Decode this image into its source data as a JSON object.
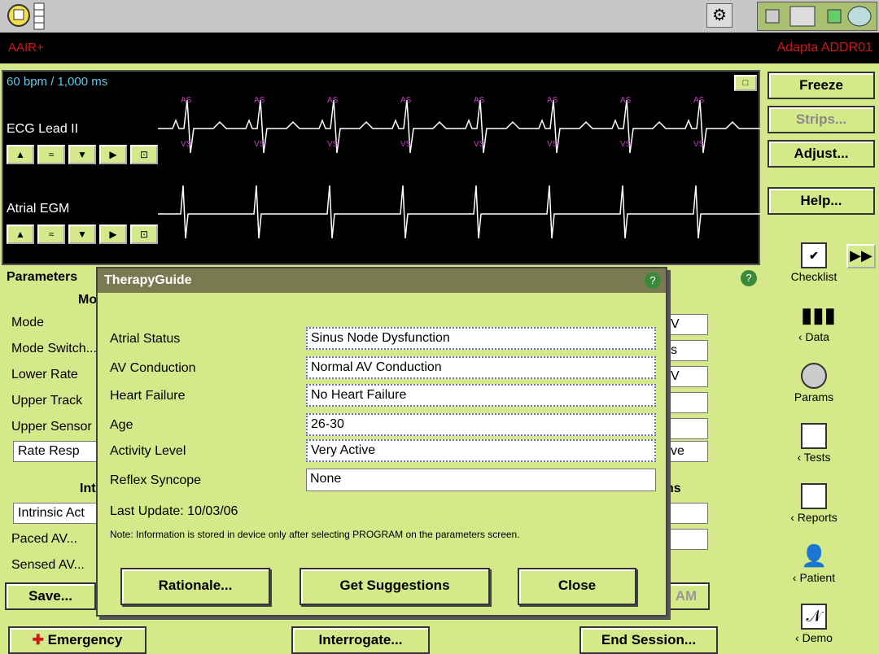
{
  "header": {
    "mode": "AAIR+",
    "device": "Adapta ADDR01"
  },
  "ecg": {
    "rate": "60 bpm / 1,000 ms",
    "lead1": "ECG Lead II",
    "lead2": "Atrial EGM",
    "marker_as": "AS",
    "marker_vs": "VS"
  },
  "side": {
    "freeze": "Freeze",
    "strips": "Strips...",
    "adjust": "Adjust...",
    "help": "Help..."
  },
  "nav": {
    "checklist": "Checklist",
    "data": "‹ Data",
    "params": "Params",
    "tests": "‹ Tests",
    "reports": "‹ Reports",
    "patient": "‹ Patient",
    "demo": "‹ Demo"
  },
  "params": {
    "title": "Parameters",
    "rows": [
      "Mode",
      "Mode Switch...",
      "Lower Rate",
      "Upper Track",
      "Upper Sensor"
    ],
    "rate_resp": "Rate Resp",
    "section2": "Int",
    "intrinsic": "Intrinsic Act",
    "paced": "Paced AV...",
    "sensed": "Sensed AV...",
    "col_heads": [
      "Mo",
      "ns"
    ],
    "right_vals": [
      "V",
      "s",
      "V",
      "",
      ""
    ],
    "right_ve": "ve",
    "save": "Save...",
    "am": "AM"
  },
  "dialog": {
    "title": "TherapyGuide",
    "fields": [
      {
        "label": "Atrial Status",
        "value": "Sinus Node Dysfunction"
      },
      {
        "label": "AV Conduction",
        "value": "Normal AV Conduction"
      },
      {
        "label": "Heart Failure",
        "value": "No Heart Failure"
      },
      {
        "label": "Age",
        "value": "26-30"
      },
      {
        "label": "Activity Level",
        "value": "Very Active"
      },
      {
        "label": "Reflex Syncope",
        "value": "None"
      }
    ],
    "last_update": "Last Update: 10/03/06",
    "note": "Note: Information is stored in device only after selecting PROGRAM on the parameters screen.",
    "rationale": "Rationale...",
    "suggest": "Get Suggestions",
    "close": "Close"
  },
  "footer": {
    "emergency": "Emergency",
    "interrogate": "Interrogate...",
    "end": "End Session..."
  }
}
